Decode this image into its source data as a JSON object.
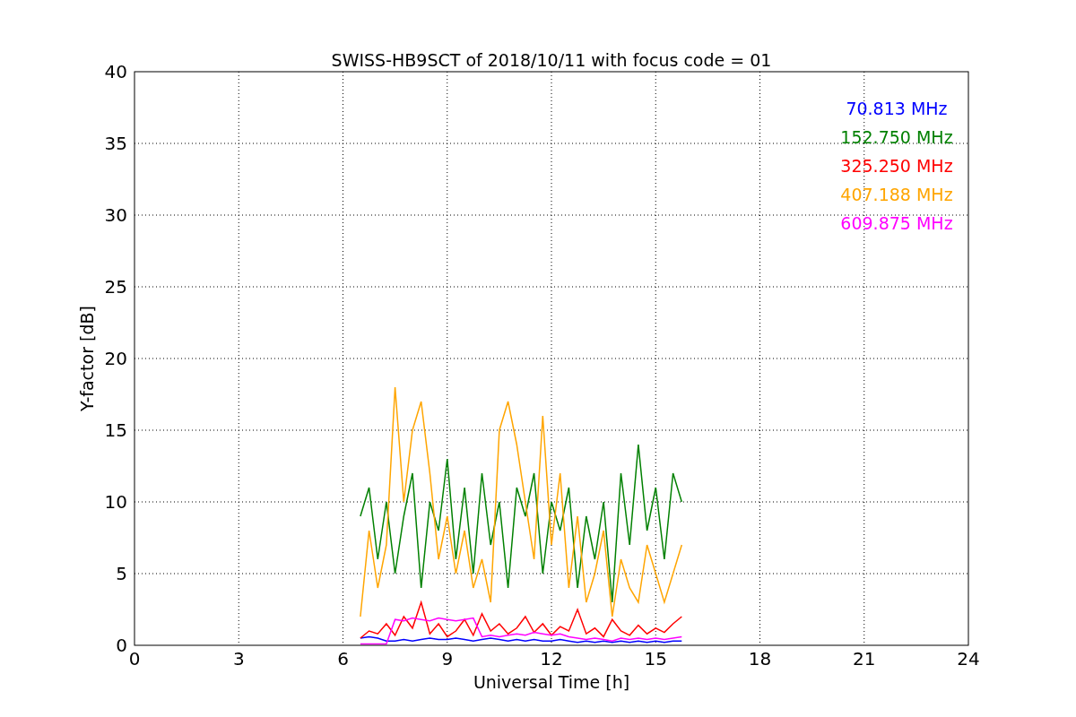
{
  "chart_data": {
    "type": "line",
    "title": "SWISS-HB9SCT of 2018/10/11 with focus code = 01",
    "xlabel": "Universal Time [h]",
    "ylabel": "Y-factor [dB]",
    "x": [
      6.5,
      6.75,
      7,
      7.25,
      7.5,
      7.75,
      8,
      8.25,
      8.5,
      8.75,
      9,
      9.25,
      9.5,
      9.75,
      10,
      10.25,
      10.5,
      10.75,
      11,
      11.25,
      11.5,
      11.75,
      12,
      12.25,
      12.5,
      12.75,
      13,
      13.25,
      13.5,
      13.75,
      14,
      14.25,
      14.5,
      14.75,
      15,
      15.25,
      15.5,
      15.75
    ],
    "series": [
      {
        "name": "70.813 MHz",
        "color": "#0000ff",
        "values": [
          0.5,
          0.6,
          0.5,
          0.3,
          0.3,
          0.4,
          0.3,
          0.4,
          0.5,
          0.4,
          0.4,
          0.5,
          0.4,
          0.3,
          0.4,
          0.5,
          0.4,
          0.3,
          0.4,
          0.3,
          0.4,
          0.3,
          0.3,
          0.4,
          0.3,
          0.2,
          0.3,
          0.2,
          0.3,
          0.2,
          0.3,
          0.2,
          0.3,
          0.2,
          0.3,
          0.2,
          0.3,
          0.3
        ]
      },
      {
        "name": "152.750 MHz",
        "color": "#008000",
        "values": [
          9,
          11,
          6,
          10,
          5,
          9,
          12,
          4,
          10,
          8,
          13,
          6,
          11,
          5,
          12,
          7,
          10,
          4,
          11,
          9,
          12,
          5,
          10,
          8,
          11,
          4,
          9,
          6,
          10,
          3,
          12,
          7,
          14,
          8,
          11,
          6,
          12,
          10
        ]
      },
      {
        "name": "325.250 MHz",
        "color": "#ff0000",
        "values": [
          0.5,
          1,
          0.8,
          1.5,
          0.7,
          2,
          1.2,
          3,
          0.8,
          1.5,
          0.6,
          1,
          1.8,
          0.7,
          2.2,
          1,
          1.5,
          0.8,
          1.2,
          2,
          0.9,
          1.5,
          0.7,
          1.3,
          1,
          2.5,
          0.8,
          1.2,
          0.6,
          1.8,
          1,
          0.7,
          1.4,
          0.8,
          1.2,
          0.9,
          1.5,
          2
        ]
      },
      {
        "name": "407.188 MHz",
        "color": "#ffa500",
        "values": [
          2,
          8,
          4,
          7,
          18,
          10,
          15,
          17,
          12,
          6,
          9,
          5,
          8,
          4,
          6,
          3,
          15,
          17,
          14,
          10,
          6,
          16,
          7,
          12,
          4,
          9,
          3,
          5,
          8,
          2,
          6,
          4,
          3,
          7,
          5,
          3,
          5,
          7
        ]
      },
      {
        "name": "609.875 MHz",
        "color": "#ff00ff",
        "values": [
          0.1,
          0.1,
          0.1,
          0.1,
          1.8,
          1.7,
          1.9,
          1.8,
          1.7,
          1.9,
          1.8,
          1.7,
          1.8,
          1.9,
          0.6,
          0.7,
          0.6,
          0.7,
          0.8,
          0.7,
          0.9,
          0.8,
          0.7,
          0.8,
          0.6,
          0.5,
          0.4,
          0.5,
          0.4,
          0.3,
          0.5,
          0.4,
          0.5,
          0.4,
          0.5,
          0.4,
          0.5,
          0.6
        ]
      }
    ],
    "xlim": [
      0,
      24
    ],
    "grid": true,
    "ylim": [
      0,
      40
    ],
    "xticks": [
      0,
      3,
      6,
      9,
      12,
      15,
      18,
      21,
      24
    ],
    "yticks": [
      0,
      5,
      10,
      15,
      20,
      25,
      30,
      35,
      40
    ]
  }
}
